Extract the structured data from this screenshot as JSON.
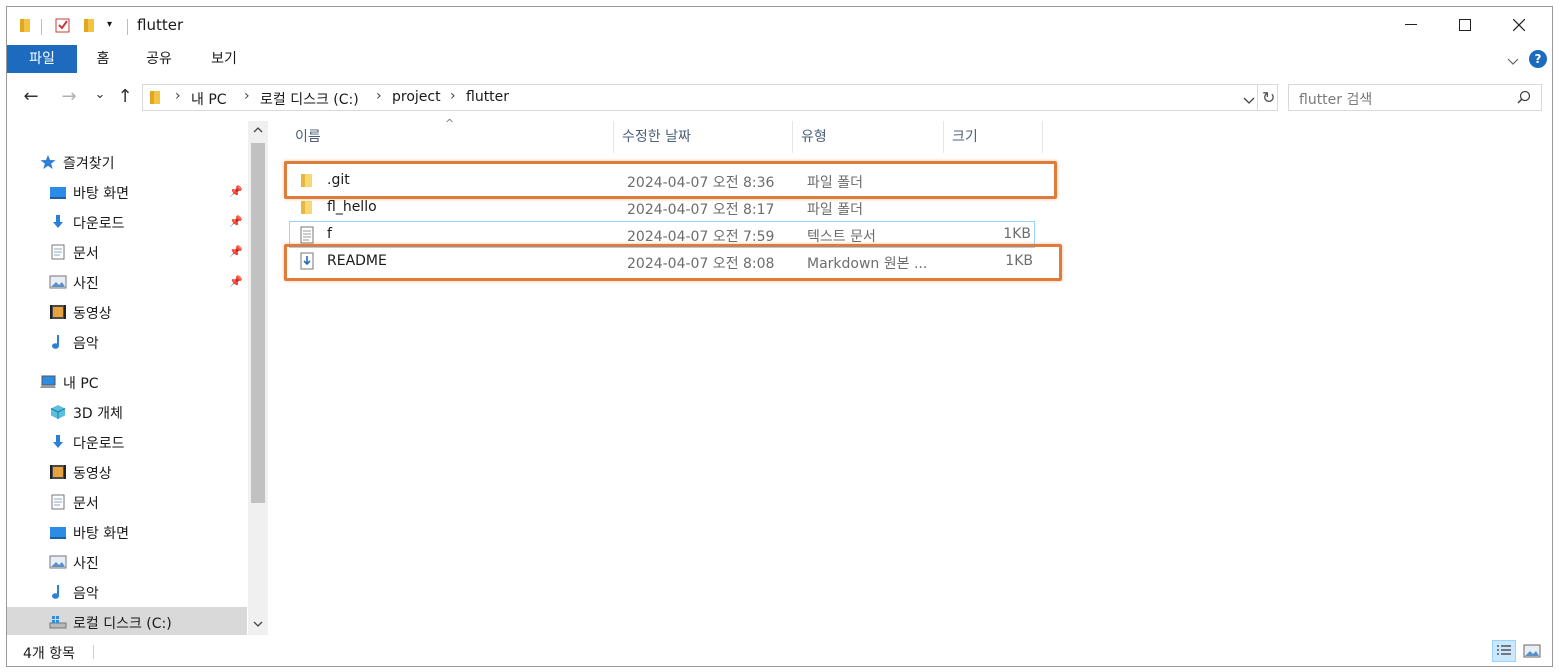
{
  "window": {
    "title": "flutter",
    "controls": {
      "minimize": "─",
      "maximize": "☐",
      "close": "✕"
    }
  },
  "ribbon": {
    "tabs": [
      {
        "label": "파일",
        "active": true
      },
      {
        "label": "홈",
        "active": false
      },
      {
        "label": "공유",
        "active": false
      },
      {
        "label": "보기",
        "active": false
      }
    ],
    "expand_icon": "chevron-down",
    "help_label": "?"
  },
  "address": {
    "back": "←",
    "forward": "→",
    "recent": "⌄",
    "up": "↑",
    "crumbs": [
      "내 PC",
      "로컬 디스크 (C:)",
      "project",
      "flutter"
    ],
    "crumb_separator": "›",
    "dropdown": "⌄",
    "refresh": "↻"
  },
  "search": {
    "placeholder": "flutter 검색",
    "icon": "search"
  },
  "sidebar": {
    "quick_access_label": "즐겨찾기",
    "quick_access": [
      {
        "label": "바탕 화면",
        "icon": "desktop",
        "pinned": true
      },
      {
        "label": "다운로드",
        "icon": "download",
        "pinned": true
      },
      {
        "label": "문서",
        "icon": "document",
        "pinned": true
      },
      {
        "label": "사진",
        "icon": "picture",
        "pinned": true
      },
      {
        "label": "동영상",
        "icon": "video",
        "pinned": false
      },
      {
        "label": "음악",
        "icon": "music",
        "pinned": false
      }
    ],
    "this_pc_label": "내 PC",
    "this_pc": [
      {
        "label": "3D 개체",
        "icon": "3d-objects"
      },
      {
        "label": "다운로드",
        "icon": "download"
      },
      {
        "label": "동영상",
        "icon": "video"
      },
      {
        "label": "문서",
        "icon": "document"
      },
      {
        "label": "바탕 화면",
        "icon": "desktop"
      },
      {
        "label": "사진",
        "icon": "picture"
      },
      {
        "label": "음악",
        "icon": "music"
      },
      {
        "label": "로컬 디스크 (C:)",
        "icon": "drive",
        "selected": true
      }
    ]
  },
  "columns": {
    "name": "이름",
    "modified": "수정한 날짜",
    "type": "유형",
    "size": "크기",
    "sort_indicator": "^"
  },
  "files": [
    {
      "name": ".git",
      "modified": "2024-04-07 오전 8:36",
      "type": "파일 폴더",
      "size": "",
      "icon": "folder",
      "highlighted": true
    },
    {
      "name": "fl_hello",
      "modified": "2024-04-07 오전 8:17",
      "type": "파일 폴더",
      "size": "",
      "icon": "folder",
      "highlighted": false
    },
    {
      "name": "f",
      "modified": "2024-04-07 오전 7:59",
      "type": "텍스트 문서",
      "size": "1KB",
      "icon": "text-file",
      "highlighted": false,
      "focused": true
    },
    {
      "name": "README",
      "modified": "2024-04-07 오전 8:08",
      "type": "Markdown 원본 ...",
      "size": "1KB",
      "icon": "markdown-file",
      "highlighted": true
    }
  ],
  "status": {
    "item_count": "4개 항목"
  },
  "colors": {
    "accent": "#1c6bbf",
    "highlight": "#e07b39",
    "selection": "#cce8ff"
  }
}
